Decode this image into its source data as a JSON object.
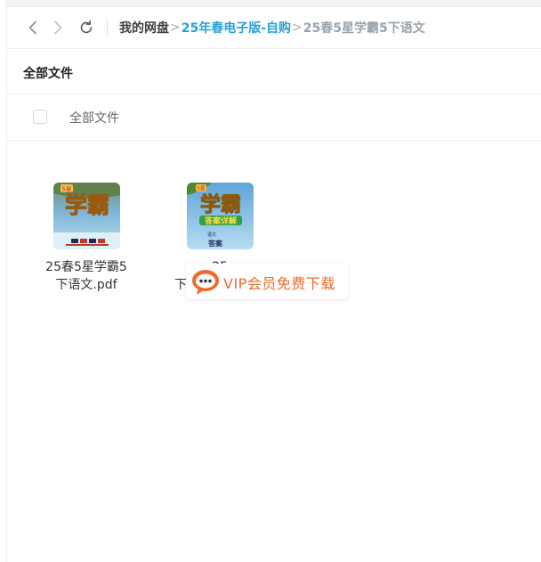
{
  "breadcrumb": {
    "root": "我的网盘",
    "separator": ">",
    "folder": "25年春电子版-自购",
    "current": "25春5星学霸5下语文"
  },
  "section": {
    "title": "全部文件"
  },
  "list_header": {
    "label": "全部文件"
  },
  "files": [
    {
      "name_line1": "25春5星学霸5",
      "name_line2": "下语文.pdf",
      "thumb_text": "学霸",
      "thumb_top_text": "5星"
    },
    {
      "name_line1": "25",
      "name_line2": "下",
      "thumb_text": "学霸",
      "thumb_top_text": "5星",
      "thumb_sub_text": "答案详解",
      "thumb_grade": "语文",
      "thumb_label": "答案"
    }
  ],
  "vip": {
    "label": "VIP会员免费下载",
    "accent": "#f06b2a"
  },
  "colors": {
    "link": "#2a9fd8",
    "current": "#9aa3ad"
  },
  "icons": {
    "back": "chevron-left-icon",
    "forward": "chevron-right-icon",
    "refresh": "refresh-icon",
    "vip": "chat-bubble-icon"
  }
}
